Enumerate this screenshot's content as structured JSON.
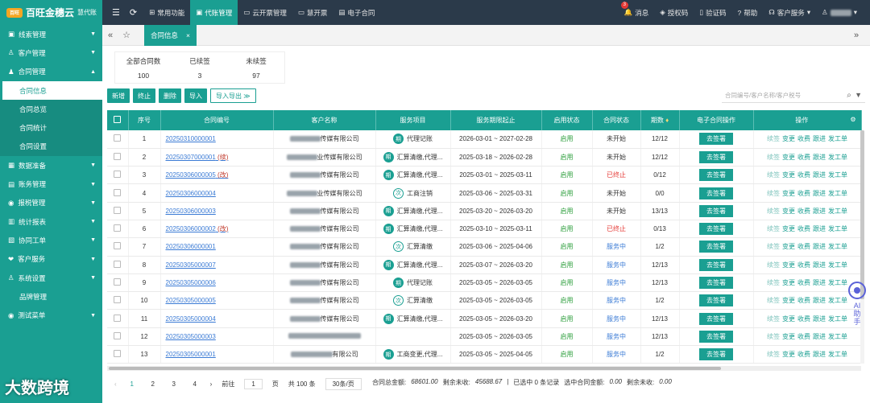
{
  "brand": {
    "logo": "百旺",
    "name": "百旺金穗云",
    "sub": "慧代账"
  },
  "topnav": [
    "常用功能",
    "代账管理",
    "云开票管理",
    "慧开票",
    "电子合同"
  ],
  "topright": {
    "badge": "3",
    "messages": "消息",
    "auth": "授权码",
    "verify": "验证码",
    "help": "帮助",
    "service": "客户服务"
  },
  "sidebar": {
    "items": [
      {
        "icon": "graph-icon",
        "label": "线索管理"
      },
      {
        "icon": "customer-icon",
        "label": "客户管理"
      },
      {
        "icon": "person-icon",
        "label": "合同管理"
      }
    ],
    "subs": [
      "合同信息",
      "合同总览",
      "合同统计",
      "合同设置"
    ],
    "items2": [
      {
        "icon": "data-icon",
        "label": "数据准备"
      },
      {
        "icon": "account-icon",
        "label": "账务管理"
      },
      {
        "icon": "tax-icon",
        "label": "报税管理"
      },
      {
        "icon": "chart-icon",
        "label": "统计报表"
      },
      {
        "icon": "collab-icon",
        "label": "协同工单"
      },
      {
        "icon": "service-icon",
        "label": "客户服务"
      },
      {
        "icon": "settings-icon",
        "label": "系统设置"
      },
      {
        "icon": "none",
        "label": "品牌管理"
      },
      {
        "icon": "test-icon",
        "label": "测试菜单"
      }
    ]
  },
  "tab": "合同信息",
  "stats": [
    {
      "label": "全部合同数",
      "value": "100"
    },
    {
      "label": "已续签",
      "value": "3"
    },
    {
      "label": "未续签",
      "value": "97"
    }
  ],
  "toolbar": {
    "new": "新增",
    "stop": "终止",
    "delete": "删除",
    "import": "导入",
    "import_export": "导入导出 ≫"
  },
  "search": {
    "placeholder": "合同编号/客户名称/客户税号"
  },
  "columns": [
    "序号",
    "合同编号",
    "客户名称",
    "服务项目",
    "服务期限起止",
    "启用状态",
    "合同状态",
    "期数",
    "电子合同操作",
    "操作"
  ],
  "rows": [
    {
      "n": "1",
      "code": "20250310000001",
      "mark": "",
      "company": "传媒有限公司",
      "icon": "期",
      "service": "代理记账",
      "period": "2026-03-01 ~ 2027-02-28",
      "enable": "启用",
      "status": "未开始",
      "term": "12/12"
    },
    {
      "n": "2",
      "code": "20250307000001",
      "mark": "(续)",
      "company": "业传媒有限公司",
      "icon": "期",
      "service": "汇算清缴,代理...",
      "period": "2025-03-18 ~ 2026-02-28",
      "enable": "启用",
      "status": "未开始",
      "term": "12/12"
    },
    {
      "n": "3",
      "code": "20250306000005",
      "mark": "(改)",
      "company": "传媒有限公司",
      "icon": "期",
      "service": "汇算清缴,代理...",
      "period": "2025-03-01 ~ 2025-03-11",
      "enable": "启用",
      "status": "已终止",
      "term": "0/12"
    },
    {
      "n": "4",
      "code": "20250306000004",
      "mark": "",
      "company": "业传媒有限公司",
      "icon": "次",
      "service": "工商注销",
      "period": "2025-03-06 ~ 2025-03-31",
      "enable": "启用",
      "status": "未开始",
      "term": "0/0"
    },
    {
      "n": "5",
      "code": "20250306000003",
      "mark": "",
      "company": "传媒有限公司",
      "icon": "期",
      "service": "汇算清缴,代理...",
      "period": "2025-03-20 ~ 2026-03-20",
      "enable": "启用",
      "status": "未开始",
      "term": "13/13"
    },
    {
      "n": "6",
      "code": "20250306000002",
      "mark": "(改)",
      "company": "传媒有限公司",
      "icon": "期",
      "service": "汇算清缴,代理...",
      "period": "2025-03-10 ~ 2025-03-11",
      "enable": "启用",
      "status": "已终止",
      "term": "0/13"
    },
    {
      "n": "7",
      "code": "20250306000001",
      "mark": "",
      "company": "传媒有限公司",
      "icon": "次",
      "service": "汇算清缴",
      "period": "2025-03-06 ~ 2025-04-06",
      "enable": "启用",
      "status": "服务中",
      "term": "1/2"
    },
    {
      "n": "8",
      "code": "20250305000007",
      "mark": "",
      "company": "传媒有限公司",
      "icon": "期",
      "service": "汇算清缴,代理...",
      "period": "2025-03-07 ~ 2026-03-20",
      "enable": "启用",
      "status": "服务中",
      "term": "12/13"
    },
    {
      "n": "9",
      "code": "20250305000006",
      "mark": "",
      "company": "传媒有限公司",
      "icon": "期",
      "service": "代理记账",
      "period": "2025-03-05 ~ 2026-03-05",
      "enable": "启用",
      "status": "服务中",
      "term": "12/13"
    },
    {
      "n": "10",
      "code": "20250305000005",
      "mark": "",
      "company": "传媒有限公司",
      "icon": "次",
      "service": "汇算清缴",
      "period": "2025-03-05 ~ 2026-03-05",
      "enable": "启用",
      "status": "服务中",
      "term": "1/2"
    },
    {
      "n": "11",
      "code": "20250305000004",
      "mark": "",
      "company": "传媒有限公司",
      "icon": "期",
      "service": "汇算清缴,代理...",
      "period": "2025-03-05 ~ 2026-03-20",
      "enable": "启用",
      "status": "服务中",
      "term": "12/13"
    },
    {
      "n": "12",
      "code": "20250305000003",
      "mark": "",
      "company": "",
      "icon": "",
      "service": "",
      "period": "2025-03-05 ~ 2026-03-05",
      "enable": "启用",
      "status": "服务中",
      "term": "12/13"
    },
    {
      "n": "13",
      "code": "20250305000001",
      "mark": "",
      "company": "有限公司",
      "icon": "期",
      "service": "工商变更,代理...",
      "period": "2025-03-05 ~ 2025-04-05",
      "enable": "启用",
      "status": "服务中",
      "term": "1/2"
    }
  ],
  "sign_label": "去签署",
  "ops": {
    "a": "续签",
    "b": "变更",
    "c": "收费",
    "d": "跟进",
    "e": "发工单"
  },
  "pager": {
    "pages": [
      "1",
      "2",
      "3",
      "4"
    ],
    "goto": "前往",
    "current": "1",
    "page_suffix": "页",
    "total": "共 100 条",
    "size": "30条/页"
  },
  "summary": {
    "total_label": "合同总金额:",
    "total": "68601.00",
    "remain_label": "剩余未收:",
    "remain": "45688.67",
    "selected": "已选中 0 条记录",
    "sel_amt_label": "选中合同金额:",
    "sel_amt": "0.00",
    "sel_remain_label": "剩余未收:",
    "sel_remain": "0.00"
  },
  "ai": {
    "a": "AI",
    "b": "助",
    "c": "手"
  },
  "watermark": "大数跨境"
}
